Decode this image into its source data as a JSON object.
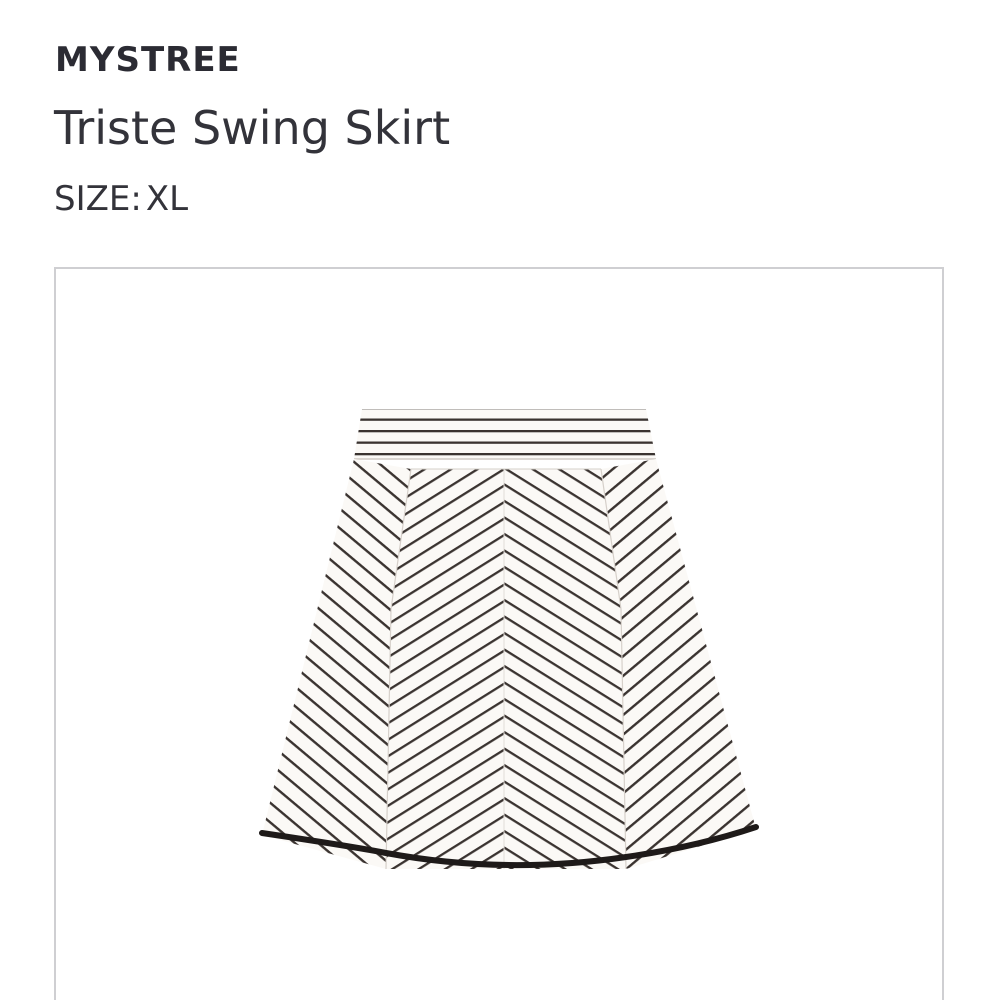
{
  "product": {
    "brand": "MYSTREE",
    "name": "Triste Swing Skirt",
    "size_label": "SIZE:",
    "size_value": "XL"
  },
  "image": {
    "subject_icon": "striped-skirt-icon",
    "stripe_color": "#3a3330",
    "fabric_color": "#fbf9f6",
    "hem_color": "#1e1a19"
  }
}
